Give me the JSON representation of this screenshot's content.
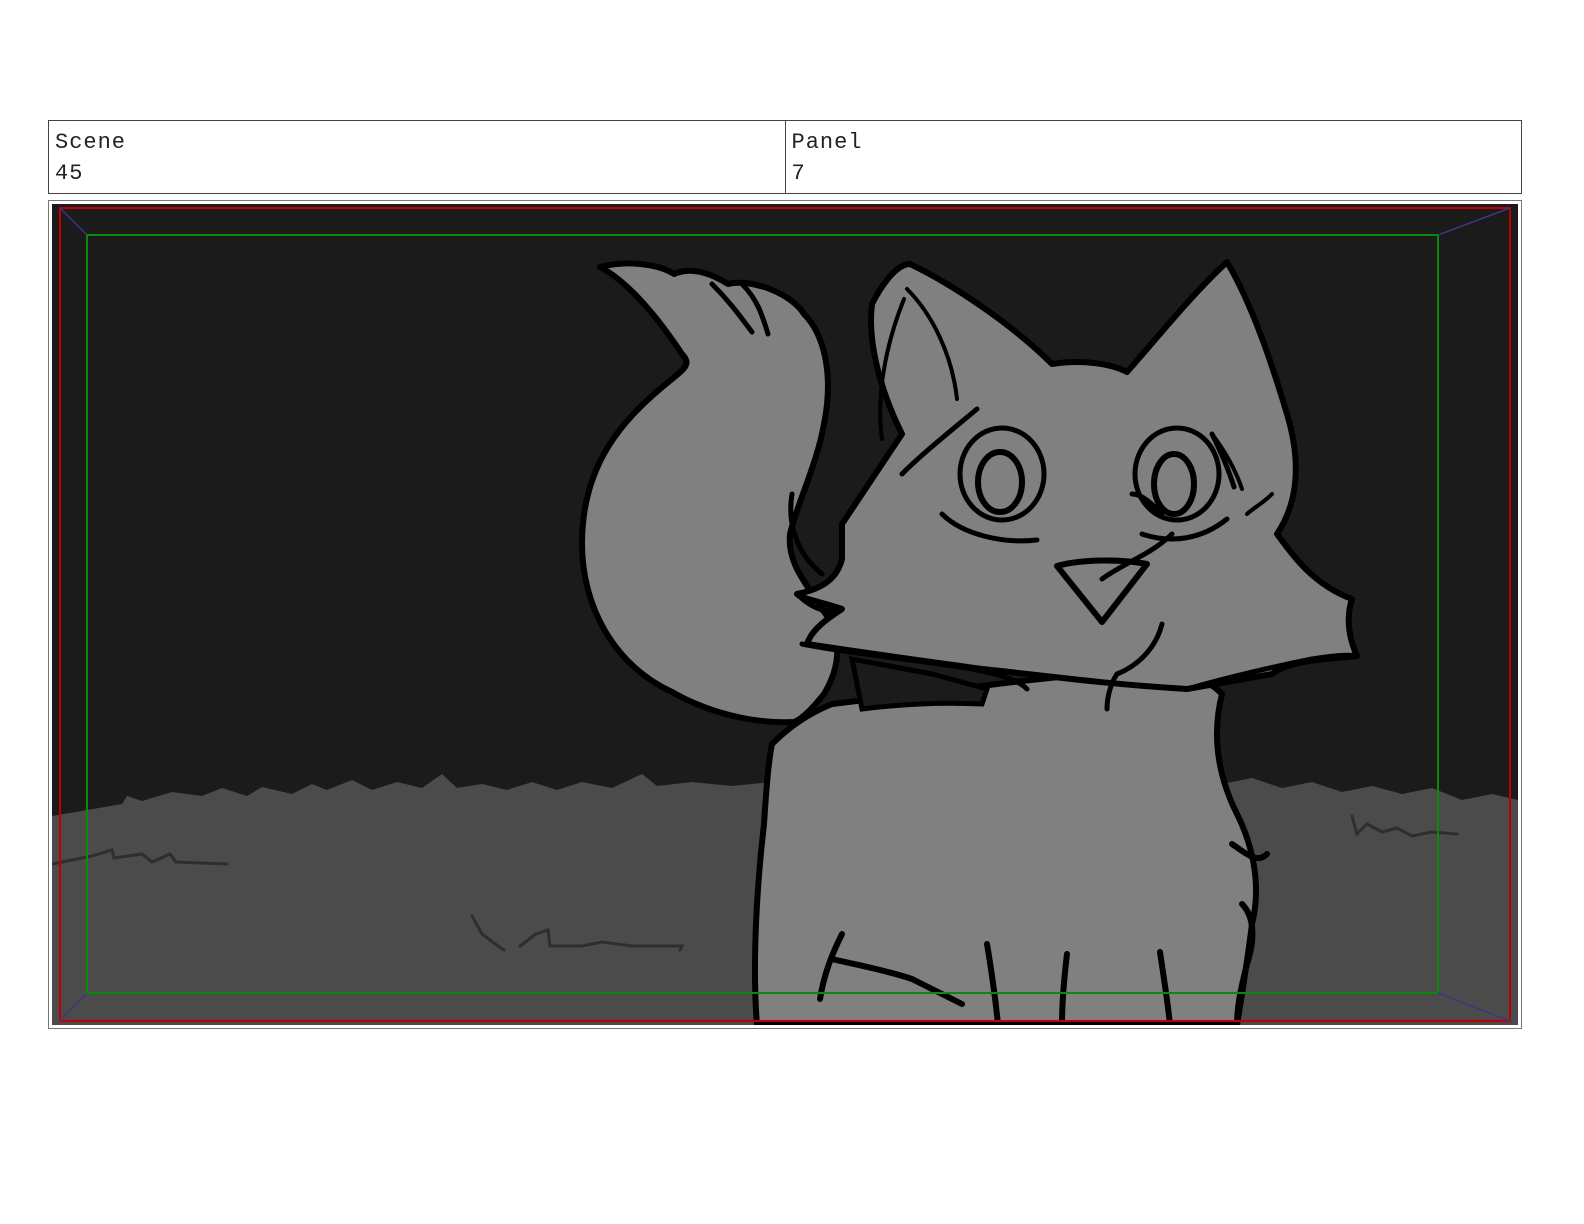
{
  "header": {
    "scene": {
      "label": "Scene",
      "value": "45"
    },
    "panel": {
      "label": "Panel",
      "value": "7"
    }
  },
  "colors": {
    "sky": "#1b1b1b",
    "grass": "#4b4b4b",
    "fox": "#808080",
    "ink": "#000000",
    "safe_frame_red": "#c00000",
    "title_safe_green": "#0a8a0a"
  }
}
